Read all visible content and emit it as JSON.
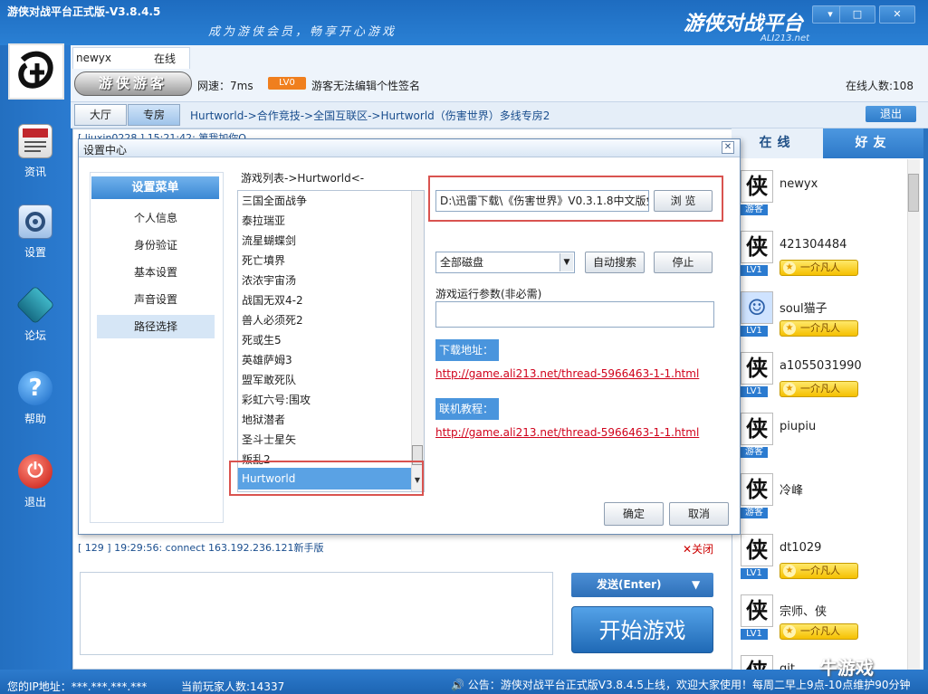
{
  "window": {
    "title": "游侠对战平台正式版-V3.8.4.5",
    "slogan": "成为游侠会员，畅享开心游戏",
    "brand": "游侠对战平台",
    "brand_url": "ALI213.net",
    "controls": [
      "▾",
      "□",
      "✕"
    ]
  },
  "sidebar": {
    "items": [
      {
        "label": "资讯",
        "icon": "news-icon"
      },
      {
        "label": "设置",
        "icon": "settings-icon"
      },
      {
        "label": "论坛",
        "icon": "forum-icon"
      },
      {
        "label": "帮助",
        "icon": "help-icon"
      },
      {
        "label": "退出",
        "icon": "power-icon"
      }
    ]
  },
  "user": {
    "name": "newyx",
    "status": "在线",
    "badge": "游侠游客",
    "ping_label": "网速：7ms",
    "level": "LV0",
    "signature": "游客无法编辑个性签名",
    "online_count": "在线人数:108"
  },
  "nav": {
    "tab_hall": "大厅",
    "tab_room": "专房",
    "breadcrumb": "Hurtworld->合作竞技->全国互联区->Hurtworld（伤害世界）多线专房2",
    "exit_room": "退出"
  },
  "chat": {
    "line_top": "[ liuxin0228 ] 15:21:42: 第我加你Q",
    "line_bottom": "[ 129 ] 19:29:56: connect 163.192.236.121新手版",
    "close_label": "关闭",
    "send_label": "发送(Enter)",
    "send_arrow": "▼",
    "start_label": "开始游戏"
  },
  "online_panel": {
    "tab_online": "在线",
    "tab_friends": "好友",
    "users": [
      {
        "name": "newyx",
        "tag": "游客",
        "rank": ""
      },
      {
        "name": "421304484",
        "tag": "LV1",
        "rank": "一介凡人"
      },
      {
        "name": "soul猫子",
        "tag": "LV1",
        "rank": "一介凡人"
      },
      {
        "name": "a1055031990",
        "tag": "LV1",
        "rank": "一介凡人"
      },
      {
        "name": "piupiu",
        "tag": "游客",
        "rank": ""
      },
      {
        "name": "冷峰",
        "tag": "游客",
        "rank": ""
      },
      {
        "name": "dt1029",
        "tag": "LV1",
        "rank": "一介凡人"
      },
      {
        "name": "宗师、侠",
        "tag": "LV1",
        "rank": "一介凡人"
      },
      {
        "name": "git",
        "tag": "",
        "rank": ""
      }
    ]
  },
  "dialog": {
    "title": "设置中心",
    "close": "✕",
    "menu_header": "设置菜单",
    "menu_items": [
      "个人信息",
      "身份验证",
      "基本设置",
      "声音设置",
      "路径选择"
    ],
    "games_label": "游戏列表->Hurtworld<-",
    "games": [
      "三国全面战争",
      "泰拉瑞亚",
      "流星蝴蝶剑",
      "死亡墳界",
      "浓浓宇宙汤",
      "战国无双4-2",
      "兽人必须死2",
      "死或生5",
      "英雄萨姆3",
      "盟军敢死队",
      "彩虹六号:围攻",
      "地狱潜者",
      "圣斗士星矢",
      "叛乱2"
    ],
    "selected_game": "Hurtworld",
    "path_value": "D:\\迅雷下载\\《伤害世界》V0.3.1.8中文版免",
    "browse": "浏 览",
    "disk_value": "全部磁盘",
    "disk_arrow": "▼",
    "auto_search": "自动搜索",
    "stop": "停止",
    "param_label": "游戏运行参数(非必需)",
    "download_label": "下载地址：",
    "download_url": "http://game.ali213.net/thread-5966463-1-1.html",
    "tutorial_label": "联机教程：",
    "tutorial_url": "http://game.ali213.net/thread-5966463-1-1.html",
    "ok": "确定",
    "cancel": "取消"
  },
  "status": {
    "ip_label": "您的IP地址：***.***.***.***",
    "player_count": "当前玩家人数:14337",
    "notice": "公告：游侠对战平台正式版V3.8.4.5上线，欢迎大家使用！每周二早上9点-10点维护90分钟"
  },
  "watermark": "牛游戏"
}
